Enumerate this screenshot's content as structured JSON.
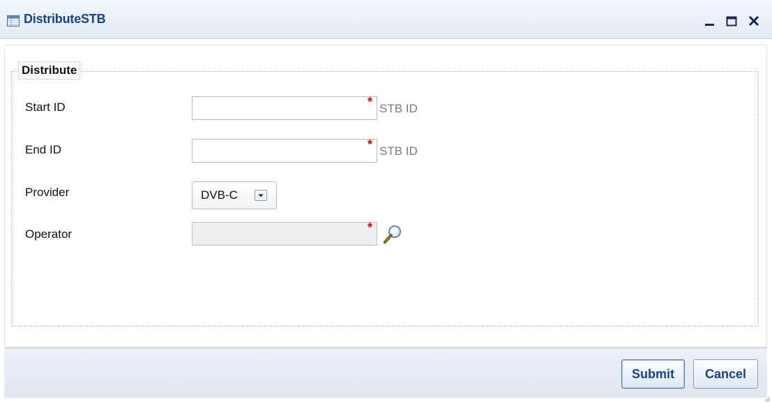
{
  "window": {
    "title": "DistributeSTB",
    "icon": "table-icon",
    "tools": [
      "minimize-icon",
      "maximize-icon",
      "close-icon"
    ]
  },
  "fieldset": {
    "legend": "Distribute"
  },
  "form": {
    "start_id": {
      "label": "Start ID",
      "value": "",
      "required": "*",
      "hint": "STB ID"
    },
    "end_id": {
      "label": "End ID",
      "value": "",
      "required": "*",
      "hint": "STB ID"
    },
    "provider": {
      "label": "Provider",
      "selected": "DVB-C"
    },
    "operator": {
      "label": "Operator",
      "value": "",
      "required": "*",
      "lookup_icon": "magnifier-icon"
    }
  },
  "footer": {
    "submit_label": "Submit",
    "cancel_label": "Cancel"
  },
  "colors": {
    "title_text": "#15428b",
    "required": "#e00000",
    "hint": "#7a7a7a",
    "header_bg": "#e2eaf2"
  }
}
